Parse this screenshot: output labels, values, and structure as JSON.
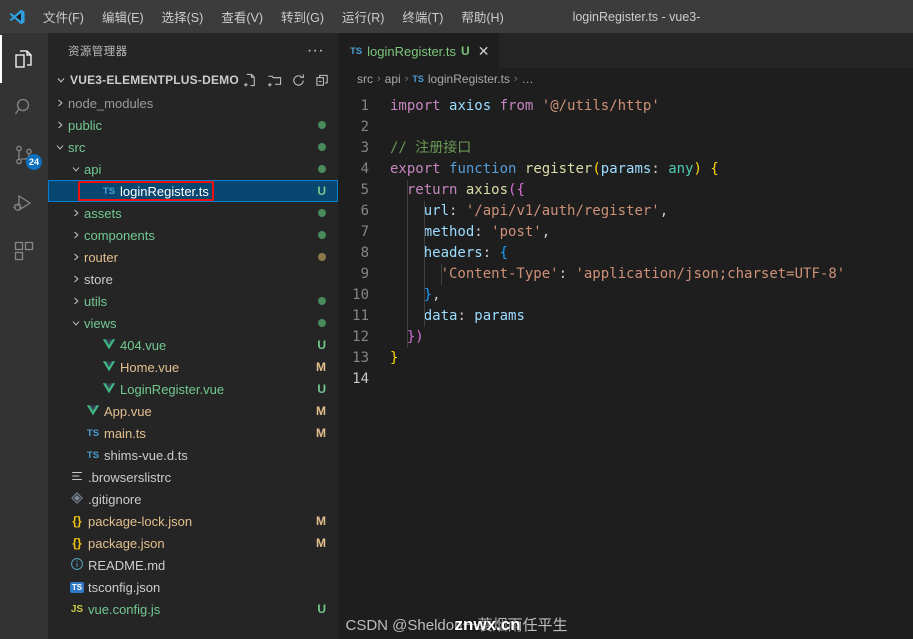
{
  "titlebar": {
    "logo_icon": "vscode-logo",
    "window_title": "loginRegister.ts - vue3-",
    "menus": [
      {
        "label": "文件(F)",
        "name": "menu-file"
      },
      {
        "label": "编辑(E)",
        "name": "menu-edit"
      },
      {
        "label": "选择(S)",
        "name": "menu-selection"
      },
      {
        "label": "查看(V)",
        "name": "menu-view"
      },
      {
        "label": "转到(G)",
        "name": "menu-go"
      },
      {
        "label": "运行(R)",
        "name": "menu-run"
      },
      {
        "label": "终端(T)",
        "name": "menu-terminal"
      },
      {
        "label": "帮助(H)",
        "name": "menu-help"
      }
    ]
  },
  "activitybar": {
    "items": [
      {
        "icon": "files-explorer-icon",
        "name": "activity-explorer",
        "active": true,
        "badge": ""
      },
      {
        "icon": "search-icon",
        "name": "activity-search",
        "active": false,
        "badge": ""
      },
      {
        "icon": "source-control-icon",
        "name": "activity-source-control",
        "active": false,
        "badge": "24"
      },
      {
        "icon": "run-debug-icon",
        "name": "activity-run-debug",
        "active": false,
        "badge": ""
      },
      {
        "icon": "extensions-icon",
        "name": "activity-extensions",
        "active": false,
        "badge": ""
      }
    ],
    "badge_color": "#0e70c0"
  },
  "sidebar": {
    "title": "资源管理器",
    "more_label": "···",
    "root_folder": "VUE3-ELEMENTPLUS-DEMO",
    "actions": [
      {
        "icon": "new-file-icon",
        "name": "new-file-button"
      },
      {
        "icon": "new-folder-icon",
        "name": "new-folder-button"
      },
      {
        "icon": "refresh-icon",
        "name": "refresh-explorer-button"
      },
      {
        "icon": "collapse-all-icon",
        "name": "collapse-all-button"
      }
    ],
    "tree": [
      {
        "label": "node_modules",
        "type": "folder",
        "expanded": false,
        "indent": 1,
        "icon": "",
        "color": "#9a9a9a",
        "status": "",
        "dot": ""
      },
      {
        "label": "public",
        "type": "folder",
        "expanded": false,
        "indent": 1,
        "icon": "",
        "color": "#73c991",
        "status": "",
        "dot": "#4a8a5c"
      },
      {
        "label": "src",
        "type": "folder",
        "expanded": true,
        "indent": 1,
        "icon": "",
        "color": "#73c991",
        "status": "",
        "dot": "#4a8a5c"
      },
      {
        "label": "api",
        "type": "folder",
        "expanded": true,
        "indent": 2,
        "icon": "",
        "color": "#73c991",
        "status": "",
        "dot": "#4a8a5c"
      },
      {
        "label": "loginRegister.ts",
        "type": "file",
        "expanded": false,
        "indent": 3,
        "icon": "ts-icon",
        "color": "#ffffff",
        "status": "U",
        "dot": "",
        "selected": true,
        "annotated": true
      },
      {
        "label": "assets",
        "type": "folder",
        "expanded": false,
        "indent": 2,
        "icon": "",
        "color": "#73c991",
        "status": "",
        "dot": "#4a8a5c"
      },
      {
        "label": "components",
        "type": "folder",
        "expanded": false,
        "indent": 2,
        "icon": "",
        "color": "#73c991",
        "status": "",
        "dot": "#4a8a5c"
      },
      {
        "label": "router",
        "type": "folder",
        "expanded": false,
        "indent": 2,
        "icon": "",
        "color": "#e2c08d",
        "status": "",
        "dot": "#8a7a4a"
      },
      {
        "label": "store",
        "type": "folder",
        "expanded": false,
        "indent": 2,
        "icon": "",
        "color": "#cccccc",
        "status": "",
        "dot": ""
      },
      {
        "label": "utils",
        "type": "folder",
        "expanded": false,
        "indent": 2,
        "icon": "",
        "color": "#73c991",
        "status": "",
        "dot": "#4a8a5c"
      },
      {
        "label": "views",
        "type": "folder",
        "expanded": true,
        "indent": 2,
        "icon": "",
        "color": "#73c991",
        "status": "",
        "dot": "#4a8a5c"
      },
      {
        "label": "404.vue",
        "type": "file",
        "expanded": false,
        "indent": 3,
        "icon": "vue-icon",
        "color": "#73c991",
        "status": "U",
        "dot": ""
      },
      {
        "label": "Home.vue",
        "type": "file",
        "expanded": false,
        "indent": 3,
        "icon": "vue-icon",
        "color": "#e2c08d",
        "status": "M",
        "dot": ""
      },
      {
        "label": "LoginRegister.vue",
        "type": "file",
        "expanded": false,
        "indent": 3,
        "icon": "vue-icon",
        "color": "#73c991",
        "status": "U",
        "dot": ""
      },
      {
        "label": "App.vue",
        "type": "file",
        "expanded": false,
        "indent": 2,
        "icon": "vue-icon",
        "color": "#e2c08d",
        "status": "M",
        "dot": ""
      },
      {
        "label": "main.ts",
        "type": "file",
        "expanded": false,
        "indent": 2,
        "icon": "ts-icon",
        "color": "#e2c08d",
        "status": "M",
        "dot": ""
      },
      {
        "label": "shims-vue.d.ts",
        "type": "file",
        "expanded": false,
        "indent": 2,
        "icon": "ts-icon",
        "color": "#cccccc",
        "status": "",
        "dot": ""
      },
      {
        "label": ".browserslistrc",
        "type": "file",
        "expanded": false,
        "indent": 1,
        "icon": "config-lines-icon",
        "color": "#cccccc",
        "status": "",
        "dot": ""
      },
      {
        "label": ".gitignore",
        "type": "file",
        "expanded": false,
        "indent": 1,
        "icon": "git-icon",
        "color": "#cccccc",
        "status": "",
        "dot": ""
      },
      {
        "label": "package-lock.json",
        "type": "file",
        "expanded": false,
        "indent": 1,
        "icon": "json-icon",
        "color": "#e2c08d",
        "status": "M",
        "dot": ""
      },
      {
        "label": "package.json",
        "type": "file",
        "expanded": false,
        "indent": 1,
        "icon": "json-icon",
        "color": "#e2c08d",
        "status": "M",
        "dot": ""
      },
      {
        "label": "README.md",
        "type": "file",
        "expanded": false,
        "indent": 1,
        "icon": "info-icon",
        "color": "#cccccc",
        "status": "",
        "dot": ""
      },
      {
        "label": "tsconfig.json",
        "type": "file",
        "expanded": false,
        "indent": 1,
        "icon": "tsq-icon",
        "color": "#cccccc",
        "status": "",
        "dot": ""
      },
      {
        "label": "vue.config.js",
        "type": "file",
        "expanded": false,
        "indent": 1,
        "icon": "js-icon",
        "color": "#73c991",
        "status": "U",
        "dot": ""
      }
    ],
    "status_colors": {
      "untracked": "#73c991",
      "modified": "#e2c08d"
    },
    "selection_bg": "#094771",
    "annotation_color": "#ee1111"
  },
  "editor": {
    "tab": {
      "icon": "ts-icon",
      "filename": "loginRegister.ts",
      "status": "U",
      "close_label": "✕"
    },
    "breadcrumb": [
      {
        "label": "src",
        "icon": ""
      },
      {
        "label": "api",
        "icon": ""
      },
      {
        "label": "loginRegister.ts",
        "icon": "ts-icon"
      },
      {
        "label": "…",
        "icon": ""
      }
    ],
    "line_numbers": [
      "1",
      "2",
      "3",
      "4",
      "5",
      "6",
      "7",
      "8",
      "9",
      "10",
      "11",
      "12",
      "13",
      "14"
    ],
    "current_line": 14,
    "code_lines": [
      "import axios from '@/utils/http'",
      "",
      "// 注册接口",
      "export function register(params: any) {",
      "  return axios({",
      "    url: '/api/v1/auth/register',",
      "    method: 'post',",
      "    headers: {",
      "      'Content-Type': 'application/json;charset=UTF-8'",
      "    },",
      "    data: params",
      "  })",
      "}",
      ""
    ]
  },
  "watermark": {
    "csdn_text": "CSDN @Sheldon一蓑烟雨任平生",
    "overlay_text": "znwx.cn"
  }
}
